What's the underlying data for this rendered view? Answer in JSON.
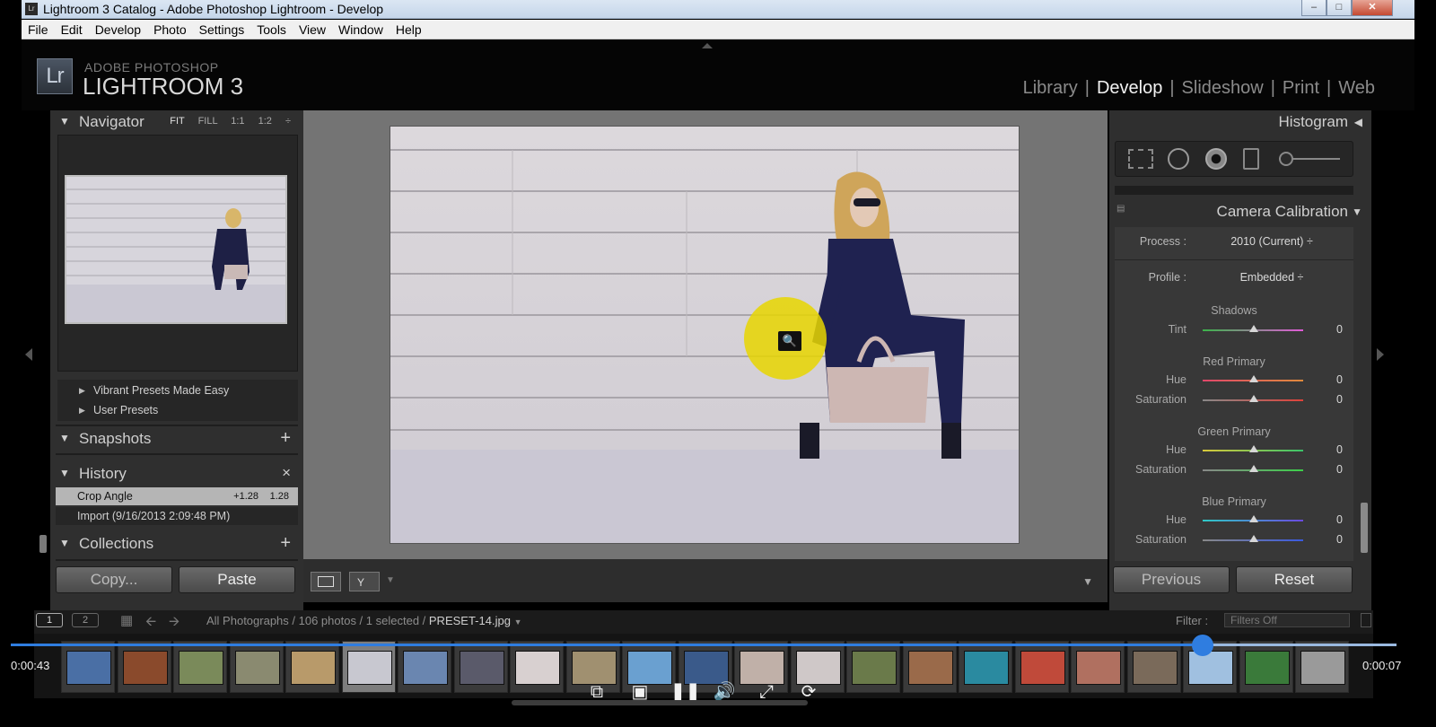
{
  "window": {
    "title": "Lightroom 3 Catalog - Adobe Photoshop Lightroom - Develop",
    "app_icon": "Lr"
  },
  "menu": [
    "File",
    "Edit",
    "Develop",
    "Photo",
    "Settings",
    "Tools",
    "View",
    "Window",
    "Help"
  ],
  "brand": {
    "logo": "Lr",
    "line1": "ADOBE PHOTOSHOP",
    "line2": "LIGHTROOM 3"
  },
  "modules": [
    {
      "label": "Library",
      "active": false
    },
    {
      "label": "Develop",
      "active": true
    },
    {
      "label": "Slideshow",
      "active": false
    },
    {
      "label": "Print",
      "active": false
    },
    {
      "label": "Web",
      "active": false
    }
  ],
  "navigator": {
    "title": "Navigator",
    "zoom_options": [
      "FIT",
      "FILL",
      "1:1",
      "1:2"
    ]
  },
  "presets": [
    "Vibrant Presets Made Easy",
    "User Presets"
  ],
  "snapshots": {
    "title": "Snapshots",
    "action": "+"
  },
  "history": {
    "title": "History",
    "action": "×",
    "items": [
      {
        "label": "Crop Angle",
        "v1": "+1.28",
        "v2": "1.28",
        "selected": true
      },
      {
        "label": "Import (9/16/2013 2:09:48 PM)",
        "v1": "",
        "v2": "",
        "selected": false
      }
    ]
  },
  "collections": {
    "title": "Collections",
    "action": "+"
  },
  "left_buttons": {
    "copy": "Copy...",
    "paste": "Paste"
  },
  "right_panel": {
    "histogram_title": "Histogram",
    "calibration_title": "Camera Calibration",
    "process": {
      "label": "Process :",
      "value": "2010 (Current) ÷"
    },
    "profile": {
      "label": "Profile :",
      "value": "Embedded ÷"
    },
    "groups": [
      {
        "title": "Shadows",
        "sliders": [
          {
            "label": "Tint",
            "value": "0",
            "gradient": "linear-gradient(90deg,#3bb34a,#e15ad8)"
          }
        ]
      },
      {
        "title": "Red Primary",
        "sliders": [
          {
            "label": "Hue",
            "value": "0",
            "gradient": "linear-gradient(90deg,#e0476a,#e08a3c)"
          },
          {
            "label": "Saturation",
            "value": "0",
            "gradient": "linear-gradient(90deg,#888,#e0423a)"
          }
        ]
      },
      {
        "title": "Green Primary",
        "sliders": [
          {
            "label": "Hue",
            "value": "0",
            "gradient": "linear-gradient(90deg,#d8c83a,#3bc46a)"
          },
          {
            "label": "Saturation",
            "value": "0",
            "gradient": "linear-gradient(90deg,#888,#3ccf4a)"
          }
        ]
      },
      {
        "title": "Blue Primary",
        "sliders": [
          {
            "label": "Hue",
            "value": "0",
            "gradient": "linear-gradient(90deg,#2fc9c6,#6a4ae0)"
          },
          {
            "label": "Saturation",
            "value": "0",
            "gradient": "linear-gradient(90deg,#888,#3a5ae0)"
          }
        ]
      }
    ],
    "previous": "Previous",
    "reset": "Reset"
  },
  "filmstrip": {
    "tabs": [
      "1",
      "2"
    ],
    "info": "All Photographs / 106 photos / 1 selected / ",
    "file": "PRESET-14.jpg",
    "filter_label": "Filter :",
    "filter_value": "Filters Off",
    "thumbs": [
      "#4a6fa5",
      "#8a4a2c",
      "#7a8a5a",
      "#8a8a70",
      "#b89a6a",
      "#c8c8d0",
      "#6a86b0",
      "#5a5a6a",
      "#d8d0d0",
      "#a09070",
      "#6aa0d0",
      "#3a5a8a",
      "#c0b0a8",
      "#cfc8c8",
      "#6a7a4a",
      "#9a6a4a",
      "#2a8aa0",
      "#c04a3a",
      "#b07060",
      "#7a6a5a",
      "#a0c0e0",
      "#3a7a3a",
      "#9a9a9a"
    ],
    "selected_index": 5
  },
  "video": {
    "elapsed": "0:00:43",
    "remaining": "0:00:07",
    "progress": 0.86
  },
  "colors": {
    "accent_blue": "#2f7de0",
    "panel": "#2f2f2f",
    "center_bg": "#747474"
  }
}
